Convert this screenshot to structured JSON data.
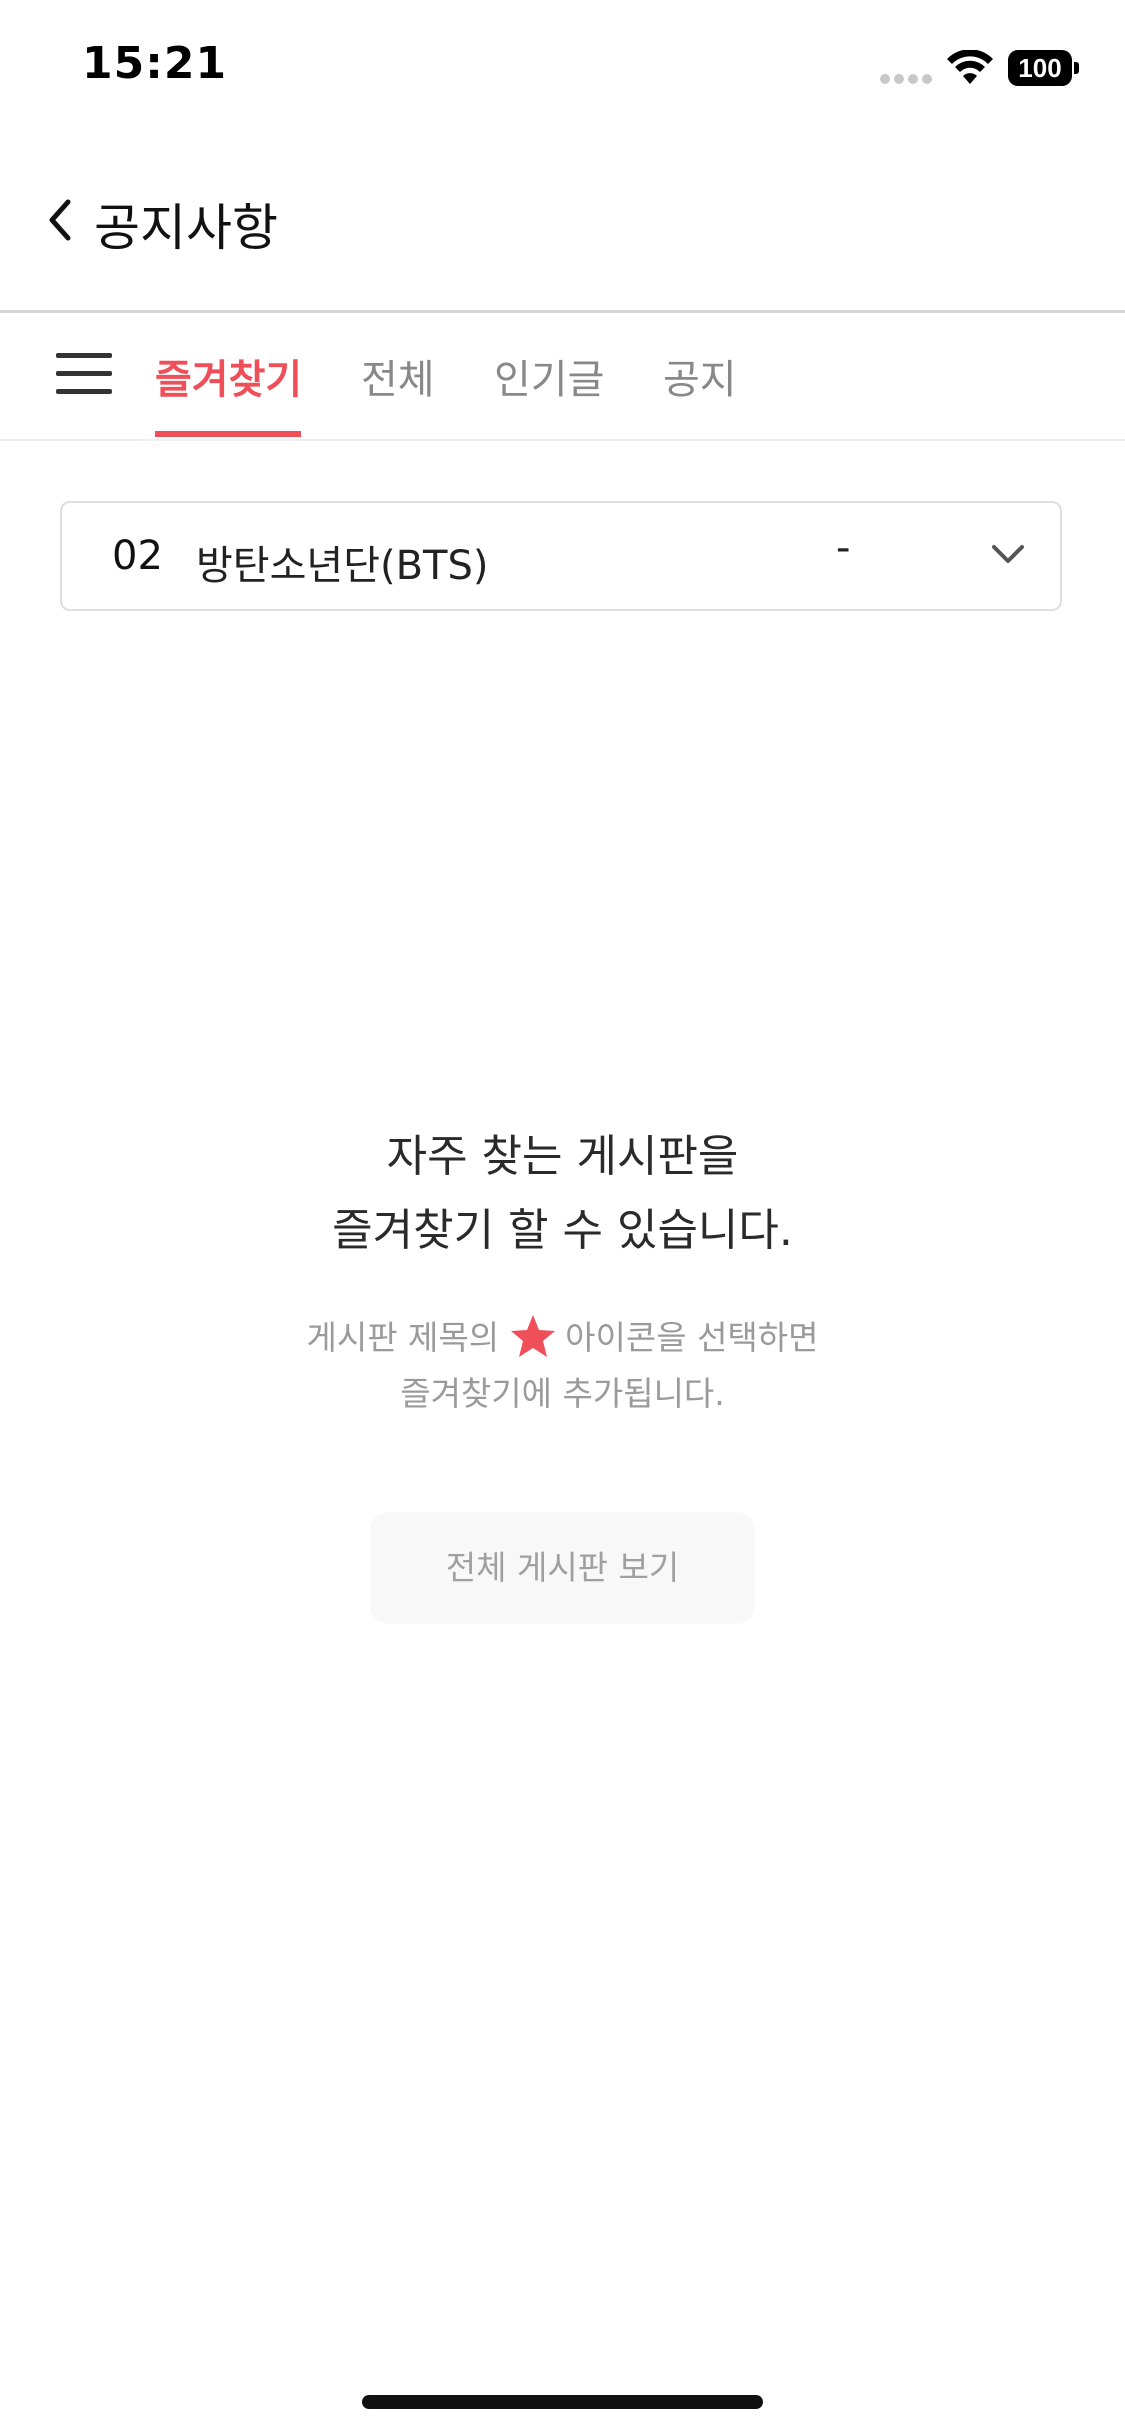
{
  "status_bar": {
    "time": "15:21",
    "battery": "100"
  },
  "header": {
    "title": "공지사항",
    "back_icon": "chevron-left-icon"
  },
  "tabs": [
    {
      "label": "즐겨찾기",
      "active": true
    },
    {
      "label": "전체",
      "active": false
    },
    {
      "label": "인기글",
      "active": false
    },
    {
      "label": "공지",
      "active": false
    }
  ],
  "board_select": {
    "number": "02",
    "name": "방탄소년단(BTS)",
    "dash": "-",
    "icon": "chevron-down-icon"
  },
  "empty_state": {
    "title_line1": "자주 찾는 게시판을",
    "title_line2": "즐겨찾기 할 수 있습니다.",
    "desc_line1_before": "게시판 제목의",
    "desc_line1_after": "아이콘을 선택하면",
    "desc_line2": "즐겨찾기에 추가됩니다.",
    "star_icon": "star-icon",
    "button_label": "전체 게시판 보기"
  },
  "colors": {
    "accent": "#ef4f58",
    "muted_text": "#9a9a9a",
    "divider": "#d6d6d6"
  }
}
